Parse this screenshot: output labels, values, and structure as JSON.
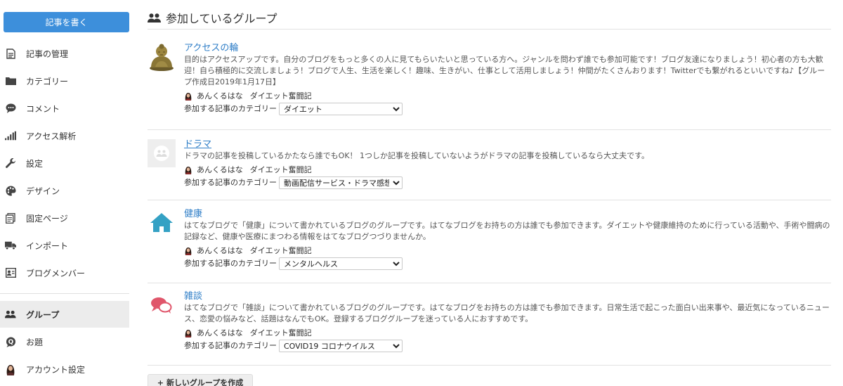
{
  "sidebar": {
    "write_button": "記事を書く",
    "items": [
      {
        "label": "記事の管理",
        "icon": "document-icon"
      },
      {
        "label": "カテゴリー",
        "icon": "folder-icon"
      },
      {
        "label": "コメント",
        "icon": "comment-icon"
      },
      {
        "label": "アクセス解析",
        "icon": "signal-bars-icon"
      },
      {
        "label": "設定",
        "icon": "wrench-icon"
      },
      {
        "label": "デザイン",
        "icon": "palette-icon"
      },
      {
        "label": "固定ページ",
        "icon": "pages-icon"
      },
      {
        "label": "インポート",
        "icon": "truck-icon"
      },
      {
        "label": "ブログメンバー",
        "icon": "member-card-icon"
      },
      {
        "label": "グループ",
        "icon": "group-icon",
        "active": true
      },
      {
        "label": "お題",
        "icon": "topic-q-icon"
      },
      {
        "label": "アカウント設定",
        "icon": "user-avatar-icon"
      }
    ]
  },
  "page": {
    "title": "参加しているグループ",
    "new_group_button": "新しいグループを作成"
  },
  "user": {
    "name": "あんくるはな",
    "blog": "ダイエット奮闘記"
  },
  "category_label": "参加する記事のカテゴリー",
  "groups": [
    {
      "title": "アクセスの輪",
      "icon": "buddha-statue-icon",
      "description": "目的はアクセスアップです。自分のブログをもっと多くの人に見てもらいたいと思っている方へ。ジャンルを問わず誰でも参加可能です！ブログ友達になりましょう！初心者の方も大歓迎！自ら積極的に交流しましょう！ブログで人生、生活を楽しく！趣味、生きがい、仕事として活用しましょう！仲間がたくさんおります！Twitterでも繋がれるといいですね♪【グループ作成日2019年1月17日】",
      "category": "ダイエット"
    },
    {
      "title": "ドラマ",
      "icon": "default-group-icon",
      "description": "ドラマの記事を投稿しているかたなら誰でもOK！ 1つしか記事を投稿していないようがドラマの記事を投稿しているなら大丈夫です。",
      "category": "動画配信サービス・ドラマ感想"
    },
    {
      "title": "健康",
      "icon": "house-icon",
      "description": "はてなブログで「健康」について書かれているブログのグループです。はてなブログをお持ちの方は誰でも参加できます。ダイエットや健康維持のために行っている活動や、手術や闘病の記録など、健康や医療にまつわる情報をはてなブログつづりませんか。",
      "category": "メンタルヘルス"
    },
    {
      "title": "雑談",
      "icon": "chat-bubbles-icon",
      "description": "はてなブログで「雑談」について書かれているブログのグループです。はてなブログをお持ちの方は誰でも参加できます。日常生活で起こった面白い出来事や、最近気になっているニュース、恋愛の悩みなど、話題はなんでもOK。登録するブロググループを迷っている人におすすめです。",
      "category": "COVID19 コロナウイルス"
    }
  ],
  "colors": {
    "accent": "#3d8fdb",
    "link": "#2f7ec7",
    "house": "#34a1c4",
    "chat": "#e0566b"
  }
}
